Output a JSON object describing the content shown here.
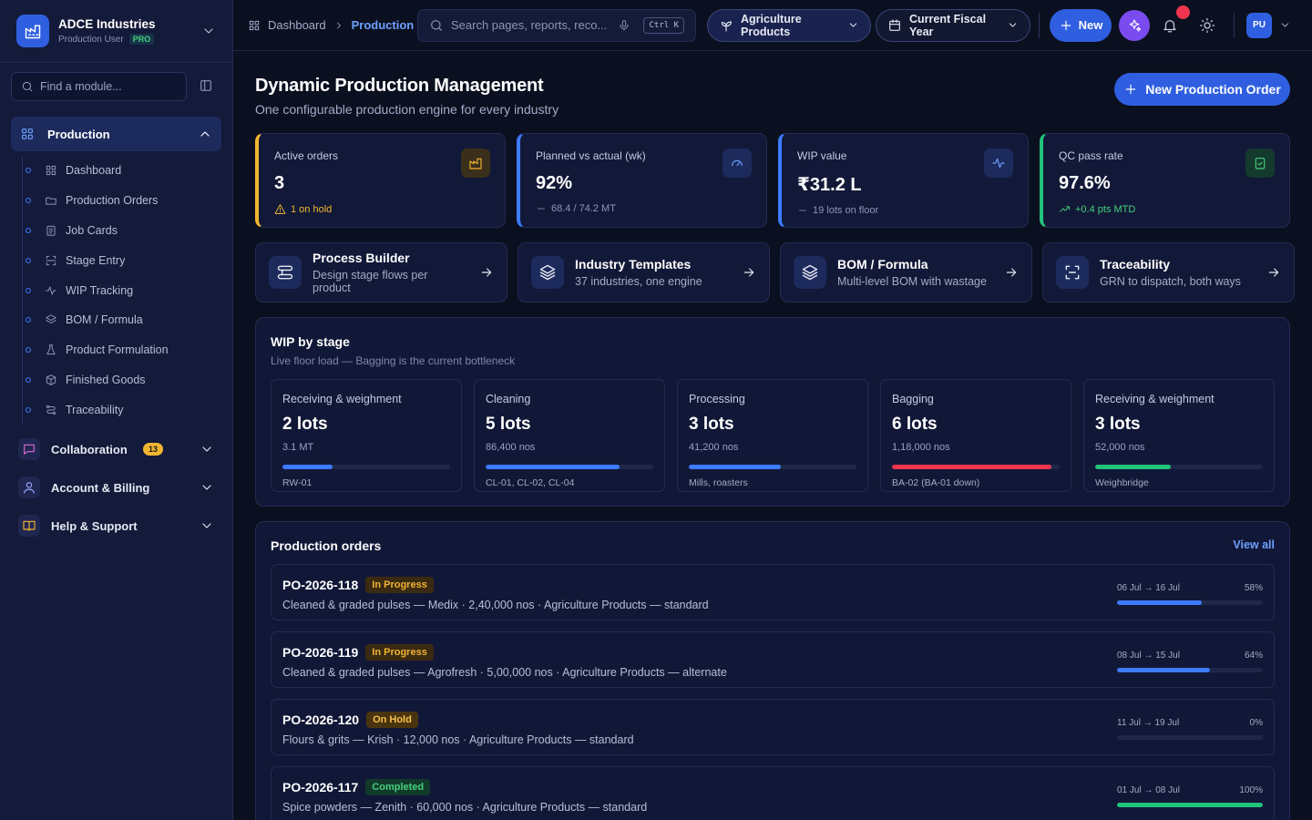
{
  "brand": {
    "name": "ADCE Industries",
    "role": "Production User",
    "tier": "PRO"
  },
  "sidebar": {
    "search_placeholder": "Find a module...",
    "active_group": "Production",
    "items": [
      {
        "label": "Dashboard",
        "icon": "grid-icon"
      },
      {
        "label": "Production Orders",
        "icon": "folder-icon"
      },
      {
        "label": "Job Cards",
        "icon": "clipboard-icon"
      },
      {
        "label": "Stage Entry",
        "icon": "scan-icon"
      },
      {
        "label": "WIP Tracking",
        "icon": "pulse-icon"
      },
      {
        "label": "BOM / Formula",
        "icon": "layers-icon"
      },
      {
        "label": "Product Formulation",
        "icon": "flask-icon"
      },
      {
        "label": "Finished Goods",
        "icon": "box-icon"
      },
      {
        "label": "Traceability",
        "icon": "route-icon"
      }
    ],
    "sections": [
      {
        "label": "Collaboration",
        "badge": "13"
      },
      {
        "label": "Account & Billing",
        "badge": ""
      },
      {
        "label": "Help & Support",
        "badge": ""
      }
    ]
  },
  "topbar": {
    "breadcrumb_root": "Dashboard",
    "breadcrumb_current": "Production",
    "search_placeholder": "Search pages, reports, reco...",
    "shortcut": "Ctrl K",
    "product_filter": "Agriculture Products",
    "period_filter": "Current Fiscal Year",
    "new_label": "New",
    "avatar_initials": "PU"
  },
  "page": {
    "title": "Dynamic Production Management",
    "subtitle": "One configurable production engine for every industry",
    "primary_action": "New Production Order"
  },
  "kpis": [
    {
      "label": "Active orders",
      "value": "3",
      "note": "1 on hold",
      "accent": "#f2b531",
      "note_color": "#f2b531"
    },
    {
      "label": "Planned vs actual (wk)",
      "value": "92%",
      "note": "68.4 / 74.2 MT",
      "accent": "#3d7bff",
      "note_color": "#8d95b8"
    },
    {
      "label": "WIP value",
      "value": "₹31.2 L",
      "note": "19 lots on floor",
      "accent": "#3d7bff",
      "note_color": "#8d95b8"
    },
    {
      "label": "QC pass rate",
      "value": "97.6%",
      "note": "+0.4 pts MTD",
      "accent": "#22c37a",
      "note_color": "#44d07c"
    }
  ],
  "tools": [
    {
      "title": "Process Builder",
      "desc": "Design stage flows per product"
    },
    {
      "title": "Industry Templates",
      "desc": "37 industries, one engine"
    },
    {
      "title": "BOM / Formula",
      "desc": "Multi-level BOM with wastage"
    },
    {
      "title": "Traceability",
      "desc": "GRN to dispatch, both ways"
    }
  ],
  "wip": {
    "title": "WIP by stage",
    "subtitle": "Live floor load — Bagging is the current bottleneck",
    "stages": [
      {
        "name": "Receiving & weighment",
        "lots": "2 lots",
        "qty": "3.1 MT",
        "ids": "RW-01",
        "load": 0.3,
        "color": "#3d7bff"
      },
      {
        "name": "Cleaning",
        "lots": "5 lots",
        "qty": "86,400 nos",
        "ids": "CL-01, CL-02, CL-04",
        "load": 0.8,
        "color": "#3d7bff"
      },
      {
        "name": "Processing",
        "lots": "3 lots",
        "qty": "41,200 nos",
        "ids": "Mills, roasters",
        "load": 0.55,
        "color": "#3d7bff"
      },
      {
        "name": "Bagging",
        "lots": "6 lots",
        "qty": "1,18,000 nos",
        "ids": "BA-02 (BA-01 down)",
        "load": 0.95,
        "color": "#f0364f"
      },
      {
        "name": "Receiving & weighment",
        "lots": "3 lots",
        "qty": "52,000 nos",
        "ids": "Weighbridge",
        "load": 0.45,
        "color": "#22c37a"
      }
    ]
  },
  "orders": {
    "title": "Production orders",
    "view_all": "View all",
    "rows": [
      {
        "po": "PO-2026-118",
        "status": "In Progress",
        "desc": "Cleaned & graded pulses — Medix · 2,40,000 nos · Agriculture Products — standard",
        "dates": "06 Jul → 16 Jul",
        "pct": "58%",
        "progress": 0.58,
        "bar_color": "#3d7bff",
        "status_bg": "#3a2a12",
        "status_fg": "#f2b531"
      },
      {
        "po": "PO-2026-119",
        "status": "In Progress",
        "desc": "Cleaned & graded pulses — Agrofresh · 5,00,000 nos · Agriculture Products — alternate",
        "dates": "08 Jul → 15 Jul",
        "pct": "64%",
        "progress": 0.64,
        "bar_color": "#3d7bff",
        "status_bg": "#3a2a12",
        "status_fg": "#f2b531"
      },
      {
        "po": "PO-2026-120",
        "status": "On Hold",
        "desc": "Flours & grits — Krish · 12,000 nos · Agriculture Products — standard",
        "dates": "11 Jul → 19 Jul",
        "pct": "0%",
        "progress": 0,
        "bar_color": "#3d7bff",
        "status_bg": "#4a3410",
        "status_fg": "#f7c24b"
      },
      {
        "po": "PO-2026-117",
        "status": "Completed",
        "desc": "Spice powders — Zenith · 60,000 nos · Agriculture Products — standard",
        "dates": "01 Jul → 08 Jul",
        "pct": "100%",
        "progress": 1,
        "bar_color": "#22c37a",
        "status_bg": "#123a2a",
        "status_fg": "#44d07c"
      }
    ]
  }
}
